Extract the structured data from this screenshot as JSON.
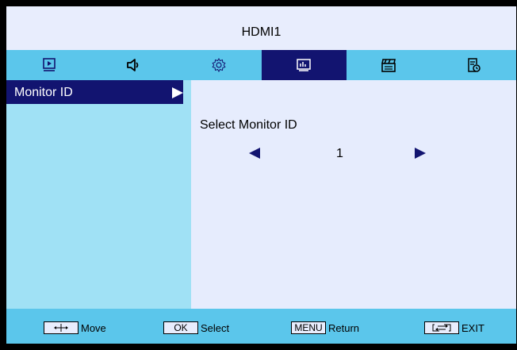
{
  "header": {
    "title": "HDMI1"
  },
  "tabs": [
    {
      "icon": "picture-icon",
      "active": false
    },
    {
      "icon": "speaker-icon",
      "active": false
    },
    {
      "icon": "gear-icon",
      "active": false
    },
    {
      "icon": "monitor-chart-icon",
      "active": true
    },
    {
      "icon": "clapperboard-icon",
      "active": false
    },
    {
      "icon": "schedule-icon",
      "active": false
    }
  ],
  "sidebar": {
    "items": [
      {
        "label": "Monitor ID",
        "selected": true
      }
    ]
  },
  "content": {
    "setting_label": "Select Monitor ID",
    "value": "1"
  },
  "footer": {
    "move": {
      "label": "Move"
    },
    "ok": {
      "key": "OK",
      "label": "Select"
    },
    "menu": {
      "key": "MENU",
      "label": "Return"
    },
    "exit": {
      "label": "EXIT"
    }
  },
  "colors": {
    "tab_bar": "#5bc6eb",
    "active_tab": "#121470",
    "sidebar": "#a0e1f5",
    "panel": "#e6ecfd"
  }
}
